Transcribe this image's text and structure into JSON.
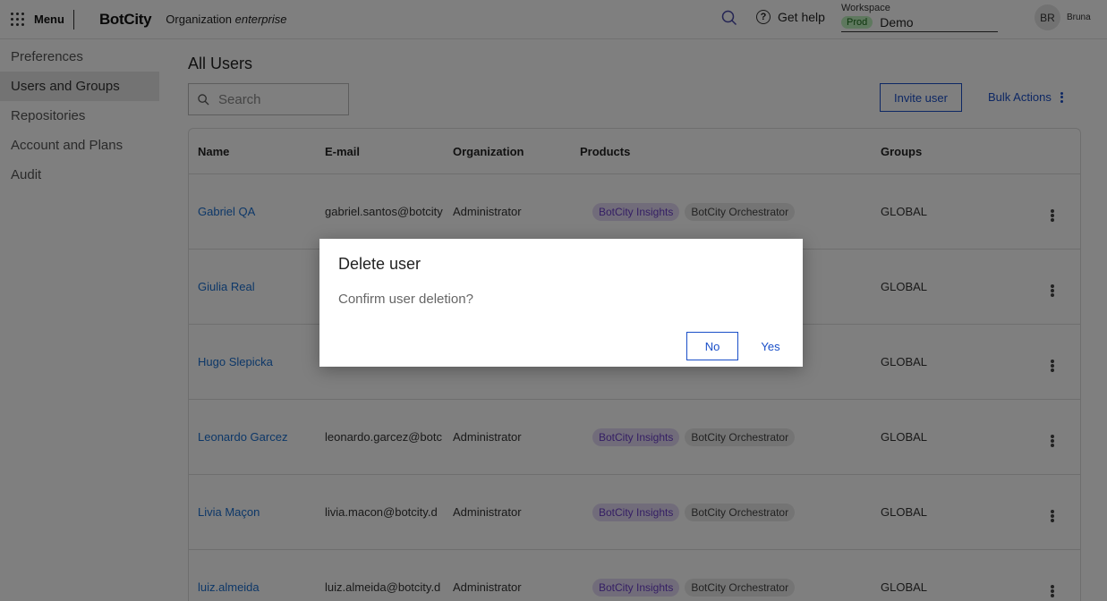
{
  "header": {
    "menu_label": "Menu",
    "logo": "BotCity",
    "org_prefix": "Organization",
    "org_name": "enterprise",
    "help_label": "Get help",
    "workspace_label": "Workspace",
    "workspace_env": "Prod",
    "workspace_name": "Demo",
    "avatar_initials": "BR",
    "user_name": "Bruna"
  },
  "sidebar": {
    "items": [
      {
        "label": "Preferences"
      },
      {
        "label": "Users and Groups"
      },
      {
        "label": "Repositories"
      },
      {
        "label": "Account and Plans"
      },
      {
        "label": "Audit"
      }
    ]
  },
  "main": {
    "title": "All Users",
    "search_placeholder": "Search",
    "invite_label": "Invite user",
    "bulk_label": "Bulk Actions"
  },
  "table": {
    "headers": [
      "Name",
      "E-mail",
      "Organization",
      "Products",
      "Groups"
    ],
    "rows": [
      {
        "name": "Gabriel QA",
        "email": "gabriel.santos@botcity",
        "org": "Administrator",
        "p1": "BotCity Insights",
        "p2": "BotCity Orchestrator",
        "group": "GLOBAL"
      },
      {
        "name": "Giulia Real",
        "email": "",
        "org": "",
        "p1": "",
        "p2": "",
        "group": "GLOBAL"
      },
      {
        "name": "Hugo Slepicka",
        "email": "",
        "org": "",
        "p1": "",
        "p2": "",
        "group": "GLOBAL"
      },
      {
        "name": "Leonardo Garcez",
        "email": "leonardo.garcez@botc",
        "org": "Administrator",
        "p1": "BotCity Insights",
        "p2": "BotCity Orchestrator",
        "group": "GLOBAL"
      },
      {
        "name": "Livia Maçon",
        "email": "livia.macon@botcity.d",
        "org": "Administrator",
        "p1": "BotCity Insights",
        "p2": "BotCity Orchestrator",
        "group": "GLOBAL"
      },
      {
        "name": "luiz.almeida",
        "email": "luiz.almeida@botcity.d",
        "org": "Administrator",
        "p1": "BotCity Insights",
        "p2": "BotCity Orchestrator",
        "group": "GLOBAL"
      }
    ]
  },
  "dialog": {
    "title": "Delete user",
    "message": "Confirm user deletion?",
    "no_label": "No",
    "yes_label": "Yes"
  }
}
